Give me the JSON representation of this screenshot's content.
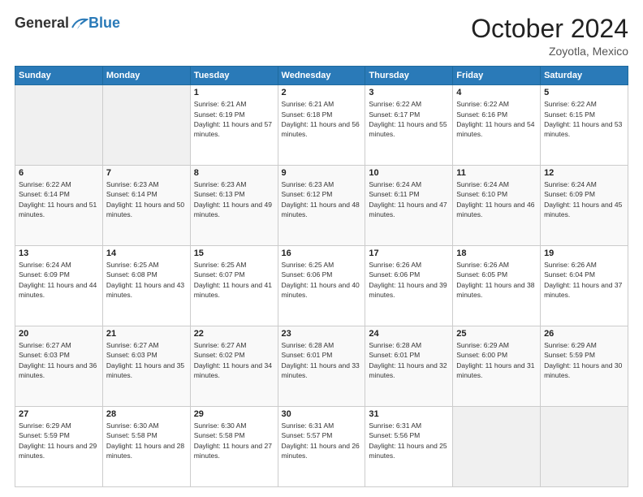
{
  "header": {
    "logo_general": "General",
    "logo_blue": "Blue",
    "month_title": "October 2024",
    "location": "Zoyotla, Mexico"
  },
  "days_of_week": [
    "Sunday",
    "Monday",
    "Tuesday",
    "Wednesday",
    "Thursday",
    "Friday",
    "Saturday"
  ],
  "weeks": [
    [
      {
        "day": "",
        "sunrise": "",
        "sunset": "",
        "daylight": ""
      },
      {
        "day": "",
        "sunrise": "",
        "sunset": "",
        "daylight": ""
      },
      {
        "day": "1",
        "sunrise": "Sunrise: 6:21 AM",
        "sunset": "Sunset: 6:19 PM",
        "daylight": "Daylight: 11 hours and 57 minutes."
      },
      {
        "day": "2",
        "sunrise": "Sunrise: 6:21 AM",
        "sunset": "Sunset: 6:18 PM",
        "daylight": "Daylight: 11 hours and 56 minutes."
      },
      {
        "day": "3",
        "sunrise": "Sunrise: 6:22 AM",
        "sunset": "Sunset: 6:17 PM",
        "daylight": "Daylight: 11 hours and 55 minutes."
      },
      {
        "day": "4",
        "sunrise": "Sunrise: 6:22 AM",
        "sunset": "Sunset: 6:16 PM",
        "daylight": "Daylight: 11 hours and 54 minutes."
      },
      {
        "day": "5",
        "sunrise": "Sunrise: 6:22 AM",
        "sunset": "Sunset: 6:15 PM",
        "daylight": "Daylight: 11 hours and 53 minutes."
      }
    ],
    [
      {
        "day": "6",
        "sunrise": "Sunrise: 6:22 AM",
        "sunset": "Sunset: 6:14 PM",
        "daylight": "Daylight: 11 hours and 51 minutes."
      },
      {
        "day": "7",
        "sunrise": "Sunrise: 6:23 AM",
        "sunset": "Sunset: 6:14 PM",
        "daylight": "Daylight: 11 hours and 50 minutes."
      },
      {
        "day": "8",
        "sunrise": "Sunrise: 6:23 AM",
        "sunset": "Sunset: 6:13 PM",
        "daylight": "Daylight: 11 hours and 49 minutes."
      },
      {
        "day": "9",
        "sunrise": "Sunrise: 6:23 AM",
        "sunset": "Sunset: 6:12 PM",
        "daylight": "Daylight: 11 hours and 48 minutes."
      },
      {
        "day": "10",
        "sunrise": "Sunrise: 6:24 AM",
        "sunset": "Sunset: 6:11 PM",
        "daylight": "Daylight: 11 hours and 47 minutes."
      },
      {
        "day": "11",
        "sunrise": "Sunrise: 6:24 AM",
        "sunset": "Sunset: 6:10 PM",
        "daylight": "Daylight: 11 hours and 46 minutes."
      },
      {
        "day": "12",
        "sunrise": "Sunrise: 6:24 AM",
        "sunset": "Sunset: 6:09 PM",
        "daylight": "Daylight: 11 hours and 45 minutes."
      }
    ],
    [
      {
        "day": "13",
        "sunrise": "Sunrise: 6:24 AM",
        "sunset": "Sunset: 6:09 PM",
        "daylight": "Daylight: 11 hours and 44 minutes."
      },
      {
        "day": "14",
        "sunrise": "Sunrise: 6:25 AM",
        "sunset": "Sunset: 6:08 PM",
        "daylight": "Daylight: 11 hours and 43 minutes."
      },
      {
        "day": "15",
        "sunrise": "Sunrise: 6:25 AM",
        "sunset": "Sunset: 6:07 PM",
        "daylight": "Daylight: 11 hours and 41 minutes."
      },
      {
        "day": "16",
        "sunrise": "Sunrise: 6:25 AM",
        "sunset": "Sunset: 6:06 PM",
        "daylight": "Daylight: 11 hours and 40 minutes."
      },
      {
        "day": "17",
        "sunrise": "Sunrise: 6:26 AM",
        "sunset": "Sunset: 6:06 PM",
        "daylight": "Daylight: 11 hours and 39 minutes."
      },
      {
        "day": "18",
        "sunrise": "Sunrise: 6:26 AM",
        "sunset": "Sunset: 6:05 PM",
        "daylight": "Daylight: 11 hours and 38 minutes."
      },
      {
        "day": "19",
        "sunrise": "Sunrise: 6:26 AM",
        "sunset": "Sunset: 6:04 PM",
        "daylight": "Daylight: 11 hours and 37 minutes."
      }
    ],
    [
      {
        "day": "20",
        "sunrise": "Sunrise: 6:27 AM",
        "sunset": "Sunset: 6:03 PM",
        "daylight": "Daylight: 11 hours and 36 minutes."
      },
      {
        "day": "21",
        "sunrise": "Sunrise: 6:27 AM",
        "sunset": "Sunset: 6:03 PM",
        "daylight": "Daylight: 11 hours and 35 minutes."
      },
      {
        "day": "22",
        "sunrise": "Sunrise: 6:27 AM",
        "sunset": "Sunset: 6:02 PM",
        "daylight": "Daylight: 11 hours and 34 minutes."
      },
      {
        "day": "23",
        "sunrise": "Sunrise: 6:28 AM",
        "sunset": "Sunset: 6:01 PM",
        "daylight": "Daylight: 11 hours and 33 minutes."
      },
      {
        "day": "24",
        "sunrise": "Sunrise: 6:28 AM",
        "sunset": "Sunset: 6:01 PM",
        "daylight": "Daylight: 11 hours and 32 minutes."
      },
      {
        "day": "25",
        "sunrise": "Sunrise: 6:29 AM",
        "sunset": "Sunset: 6:00 PM",
        "daylight": "Daylight: 11 hours and 31 minutes."
      },
      {
        "day": "26",
        "sunrise": "Sunrise: 6:29 AM",
        "sunset": "Sunset: 5:59 PM",
        "daylight": "Daylight: 11 hours and 30 minutes."
      }
    ],
    [
      {
        "day": "27",
        "sunrise": "Sunrise: 6:29 AM",
        "sunset": "Sunset: 5:59 PM",
        "daylight": "Daylight: 11 hours and 29 minutes."
      },
      {
        "day": "28",
        "sunrise": "Sunrise: 6:30 AM",
        "sunset": "Sunset: 5:58 PM",
        "daylight": "Daylight: 11 hours and 28 minutes."
      },
      {
        "day": "29",
        "sunrise": "Sunrise: 6:30 AM",
        "sunset": "Sunset: 5:58 PM",
        "daylight": "Daylight: 11 hours and 27 minutes."
      },
      {
        "day": "30",
        "sunrise": "Sunrise: 6:31 AM",
        "sunset": "Sunset: 5:57 PM",
        "daylight": "Daylight: 11 hours and 26 minutes."
      },
      {
        "day": "31",
        "sunrise": "Sunrise: 6:31 AM",
        "sunset": "Sunset: 5:56 PM",
        "daylight": "Daylight: 11 hours and 25 minutes."
      },
      {
        "day": "",
        "sunrise": "",
        "sunset": "",
        "daylight": ""
      },
      {
        "day": "",
        "sunrise": "",
        "sunset": "",
        "daylight": ""
      }
    ]
  ]
}
